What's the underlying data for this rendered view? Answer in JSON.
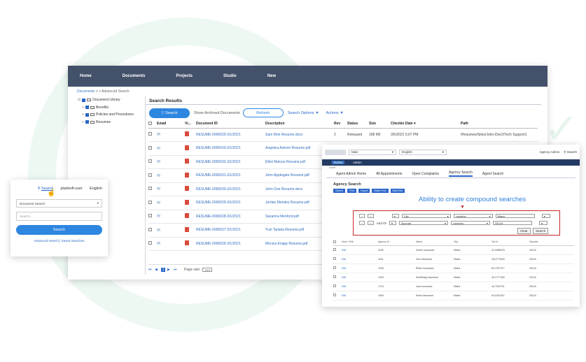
{
  "main": {
    "nav": [
      "Home",
      "Documents",
      "Projects",
      "Studio",
      "New"
    ],
    "breadcrumb": {
      "root": "Documents",
      "sep": ">",
      "sep2": ">",
      "current": "Advanced Search"
    },
    "tree": [
      {
        "label": "Document Library",
        "plus": ""
      },
      {
        "label": "Benefits",
        "plus": "+"
      },
      {
        "label": "Policies and Procedures",
        "plus": "+"
      },
      {
        "label": "Resumes",
        "plus": "+"
      }
    ],
    "results_title": "Search Results",
    "toolbar": {
      "search": "Search",
      "show_archived": "Show Archived Documents",
      "refresh": "Refresh",
      "search_options": "Search Options",
      "actions": "Actions"
    },
    "columns": [
      "Email",
      "Vi...",
      "Document ID",
      "Description",
      "Rev",
      "Status",
      "Size",
      "Checkin Date",
      "Path"
    ],
    "rows": [
      {
        "id": "RESUME-0000025-3/1/2021",
        "desc": "Sam Mori Resume.docx",
        "rev": "2",
        "status": "Released",
        "size": "168 KB",
        "date": "3/5/2021 5:07 PM",
        "path": "/Resumes/Sites/John-Doe2/Tech Support1"
      },
      {
        "id": "RESUME-0000033-3/1/2021",
        "desc": "Angelica Astrom Resume.pdf",
        "rev": "",
        "status": "",
        "size": "",
        "date": "",
        "path": ""
      },
      {
        "id": "RESUME-0000032-3/1/2021",
        "desc": "Elliot Malone Resume.pdf",
        "rev": "",
        "status": "",
        "size": "",
        "date": "",
        "path": ""
      },
      {
        "id": "RESUME-0000031-3/1/2021",
        "desc": "John Applegate Resume.pdf",
        "rev": "",
        "status": "",
        "size": "",
        "date": "",
        "path": ""
      },
      {
        "id": "RESUME-0000030-3/1/2021",
        "desc": "John Doe Resume.docx",
        "rev": "",
        "status": "",
        "size": "",
        "date": "",
        "path": ""
      },
      {
        "id": "RESUME-0000029-3/1/2021",
        "desc": "Jordan Mendez Resume.pdf",
        "rev": "",
        "status": "",
        "size": "",
        "date": "",
        "path": ""
      },
      {
        "id": "RESUME-0000028-3/1/2021",
        "desc": "Savanna Menford.pdf",
        "rev": "",
        "status": "",
        "size": "",
        "date": "",
        "path": ""
      },
      {
        "id": "RESUME-0000027-3/1/2021",
        "desc": "Yuzi Tanaka Resume.pdf",
        "rev": "",
        "status": "",
        "size": "",
        "date": "",
        "path": ""
      },
      {
        "id": "RESUME-0000026-3/1/2021",
        "desc": "Monica Knapp Resume.pdf",
        "rev": "",
        "status": "",
        "size": "",
        "date": "",
        "path": ""
      }
    ],
    "pager": {
      "page": "1",
      "size_label": "Page size:",
      "size": "15"
    }
  },
  "small": {
    "search_link": "Search",
    "user": "pladsoft.user",
    "language": "English",
    "select": "Document Search",
    "placeholder": "Search...",
    "button": "Search",
    "footer": "Advanced Search | Saved Searches"
  },
  "agency": {
    "top_select1": "Main",
    "top_select2": "English",
    "top_right_user": "Agency Admin",
    "top_right_search": "Search",
    "nav": [
      "Home",
      "Admin"
    ],
    "crumb": "Home",
    "tabs": [
      "Agent Admin Home",
      "All Appointments",
      "Open Complaints",
      "Agency Search",
      "Agent Search"
    ],
    "title": "Agency Search",
    "buttons": [
      "Search",
      "Print",
      "Export",
      "Batch Print",
      "Multi Edit"
    ],
    "annotation": "Ability to create compound searches",
    "row1": {
      "field": "City",
      "op": "contains",
      "value": "Miami"
    },
    "row2": {
      "field": "Zipcode",
      "op": "contains",
      "value": "33134"
    },
    "and_or": "And  Or",
    "clear": "Clear",
    "search": "Search",
    "columns": [
      "View / Edit",
      "Agency Id",
      "Name",
      "City",
      "Tax Id",
      "Zipcode"
    ],
    "rows": [
      {
        "edit": "Edit",
        "id": "1199",
        "name": "Vinder Insurance",
        "city": "Miami",
        "tax": "22-0958078",
        "zip": "33134"
      },
      {
        "edit": "Edit",
        "id": "1181",
        "name": "Viva Insurance",
        "city": "Miami",
        "tax": "18-3773339",
        "zip": "33134"
      },
      {
        "edit": "Edit",
        "id": "1006",
        "name": "Rhino Insurance",
        "city": "Miami",
        "tax": "83-7327077",
        "zip": "33134"
      },
      {
        "edit": "Edit",
        "id": "1043",
        "name": "Shuffletag Insurance",
        "city": "Miami",
        "tax": "40-1777463",
        "zip": "33134"
      },
      {
        "edit": "Edit",
        "id": "1723",
        "name": "Jazz Insurance",
        "city": "Miami",
        "tax": "40-7520731",
        "zip": "33134"
      },
      {
        "edit": "Edit",
        "id": "1596",
        "name": "Kimia Insurance",
        "city": "Miami",
        "tax": "94-0291007",
        "zip": "33134"
      }
    ]
  }
}
